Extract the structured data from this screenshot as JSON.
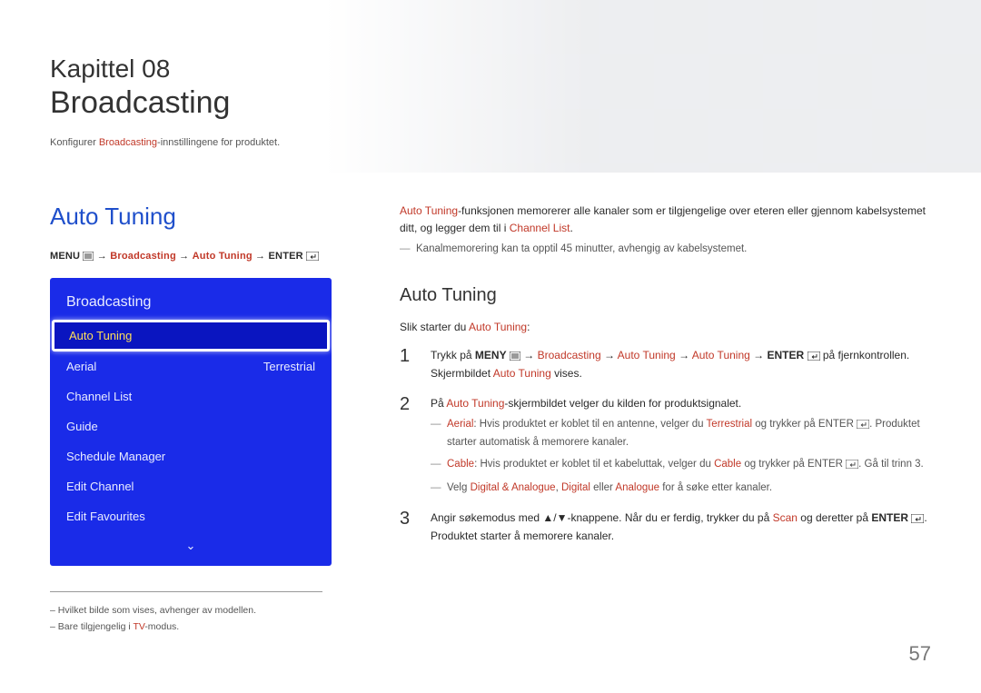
{
  "header": {
    "chapter_line": "Kapittel 08",
    "chapter_title": "Broadcasting",
    "intro_pre": "Konfigurer ",
    "intro_hl": "Broadcasting",
    "intro_post": "-innstillingene for produktet."
  },
  "left": {
    "section_heading": "Auto Tuning",
    "nav": {
      "menu_label": "MENU",
      "arrow": "→",
      "seg1": "Broadcasting",
      "seg2": "Auto Tuning",
      "enter_label": "ENTER"
    },
    "osd": {
      "title": "Broadcasting",
      "items": [
        {
          "label": "Auto Tuning",
          "value": "",
          "selected": true
        },
        {
          "label": "Aerial",
          "value": "Terrestrial",
          "selected": false
        },
        {
          "label": "Channel List",
          "value": "",
          "selected": false
        },
        {
          "label": "Guide",
          "value": "",
          "selected": false
        },
        {
          "label": "Schedule Manager",
          "value": "",
          "selected": false
        },
        {
          "label": "Edit Channel",
          "value": "",
          "selected": false
        },
        {
          "label": "Edit Favourites",
          "value": "",
          "selected": false
        }
      ]
    },
    "footnotes": {
      "f1": "– Hvilket bilde som vises, avhenger av modellen.",
      "f2_pre": "– Bare tilgjengelig i ",
      "f2_hl": "TV",
      "f2_post": "-modus."
    }
  },
  "right": {
    "para1_hl": "Auto Tuning",
    "para1_mid": "-funksjonen memorerer alle kanaler som er tilgjengelige over eteren eller gjennom kabelsystemet ditt, og legger dem til i ",
    "para1_hl2": "Channel List",
    "para1_end": ".",
    "dash1": "Kanalmemorering kan ta opptil 45 minutter, avhengig av kabelsystemet.",
    "sub_heading": "Auto Tuning",
    "intro2_pre": "Slik starter du ",
    "intro2_hl": "Auto Tuning",
    "intro2_post": ":",
    "steps": [
      {
        "num": "1",
        "text_pre": "Trykk på ",
        "text_b1": "MENY",
        "text_mid1": " ",
        "arrow": "→",
        "hl1": "Broadcasting",
        "hl2": "Auto Tuning",
        "hl3": "Auto Tuning",
        "text_b2": "ENTER",
        "tail": " på fjernkontrollen. Skjermbildet ",
        "hl4": "Auto Tuning",
        "tail2": " vises.",
        "subs": []
      },
      {
        "num": "2",
        "text_pre": "På ",
        "hl1": "Auto Tuning",
        "text_post": "-skjermbildet velger du kilden for produktsignalet.",
        "subs": [
          {
            "hl_a": "Aerial",
            "mid": ": Hvis produktet er koblet til en antenne, velger du ",
            "hl_b": "Terrestrial",
            "tail": " og trykker på ENTER ",
            "tail2": ". Produktet starter automatisk å memorere kanaler."
          },
          {
            "hl_a": "Cable",
            "mid": ": Hvis produktet er koblet til et kabeluttak, velger du ",
            "hl_b": "Cable",
            "tail": " og trykker på ENTER ",
            "tail2": ". Gå til trinn 3."
          },
          {
            "pre": "Velg ",
            "hl_a": "Digital & Analogue",
            "comma1": ", ",
            "hl_b": "Digital",
            "mid2": " eller ",
            "hl_c": "Analogue",
            "tail": " for å søke etter kanaler."
          }
        ]
      },
      {
        "num": "3",
        "text_pre": "Angir søkemodus med ▲/▼-knappene. Når du er ferdig, trykker du på ",
        "hl1": "Scan",
        "text_mid": " og deretter på ",
        "b1": "ENTER",
        "tail": ". Produktet starter å memorere kanaler.",
        "subs": []
      }
    ]
  },
  "page_number": "57"
}
